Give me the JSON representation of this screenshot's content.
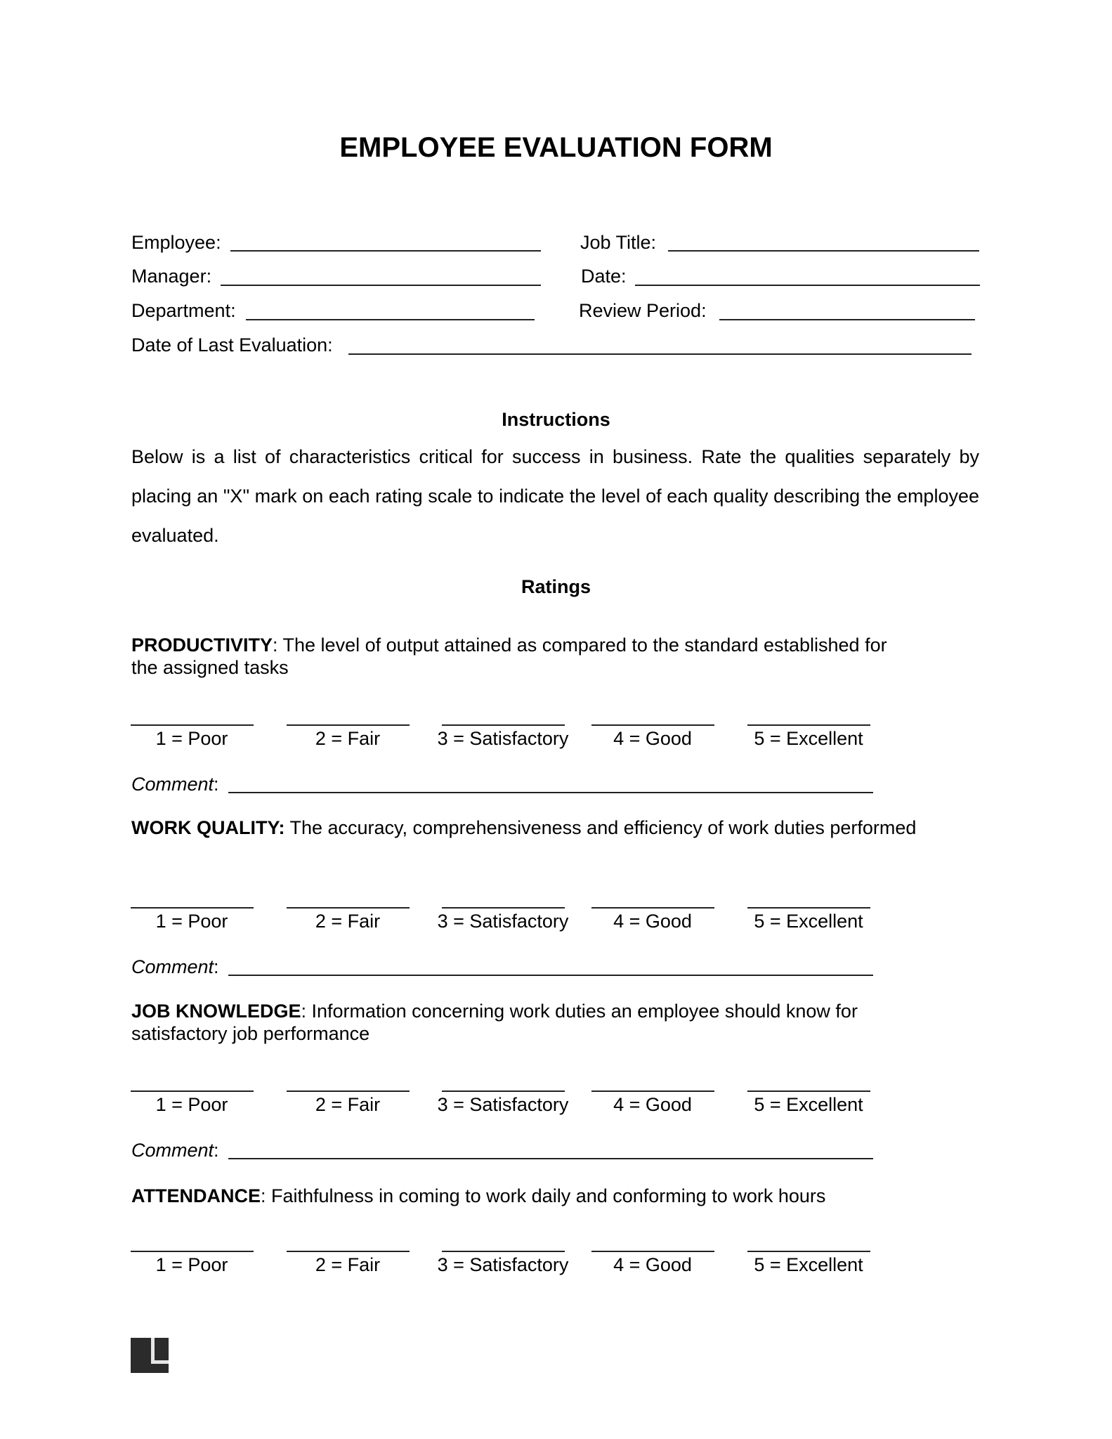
{
  "document": {
    "title": "EMPLOYEE EVALUATION FORM"
  },
  "header_fields": {
    "employee": {
      "label": "Employee:",
      "value": ""
    },
    "job_title": {
      "label": "Job Title:",
      "value": ""
    },
    "manager": {
      "label": "Manager:",
      "value": ""
    },
    "date": {
      "label": "Date:",
      "value": ""
    },
    "department": {
      "label": "Department:",
      "value": ""
    },
    "review_period": {
      "label": "Review Period:",
      "value": ""
    },
    "last_evaluation": {
      "label": "Date of Last Evaluation:",
      "value": ""
    }
  },
  "instructions": {
    "heading": "Instructions",
    "text": "Below is a list of characteristics critical for success in business. Rate the qualities separately by placing an \"X\" mark on each rating scale to indicate the level of each quality describing the employee evaluated."
  },
  "ratings": {
    "heading": "Ratings",
    "scale": [
      "1 = Poor",
      "2 = Fair",
      "3 = Satisfactory",
      "4 = Good",
      "5 = Excellent"
    ],
    "comment_label": "Comment",
    "comment_colon": ":",
    "criteria": [
      {
        "name": "PRODUCTIVITY",
        "name_colon_bold": false,
        "description": "The level of output attained as compared to the standard established for the assigned tasks",
        "has_comment": true
      },
      {
        "name": "WORK QUALITY:",
        "name_colon_bold": true,
        "description": "The accuracy, comprehensiveness and efficiency of work duties performed",
        "has_comment": true
      },
      {
        "name": "JOB KNOWLEDGE",
        "name_colon_bold": false,
        "description": "Information concerning work duties an employee should know for satisfactory job performance",
        "has_comment": true
      },
      {
        "name": "ATTENDANCE",
        "name_colon_bold": false,
        "description": "Faithfulness in coming to work daily and conforming to work hours",
        "has_comment": false
      }
    ]
  },
  "footer": {
    "logo_icon": "legal-templates-logo-icon"
  }
}
